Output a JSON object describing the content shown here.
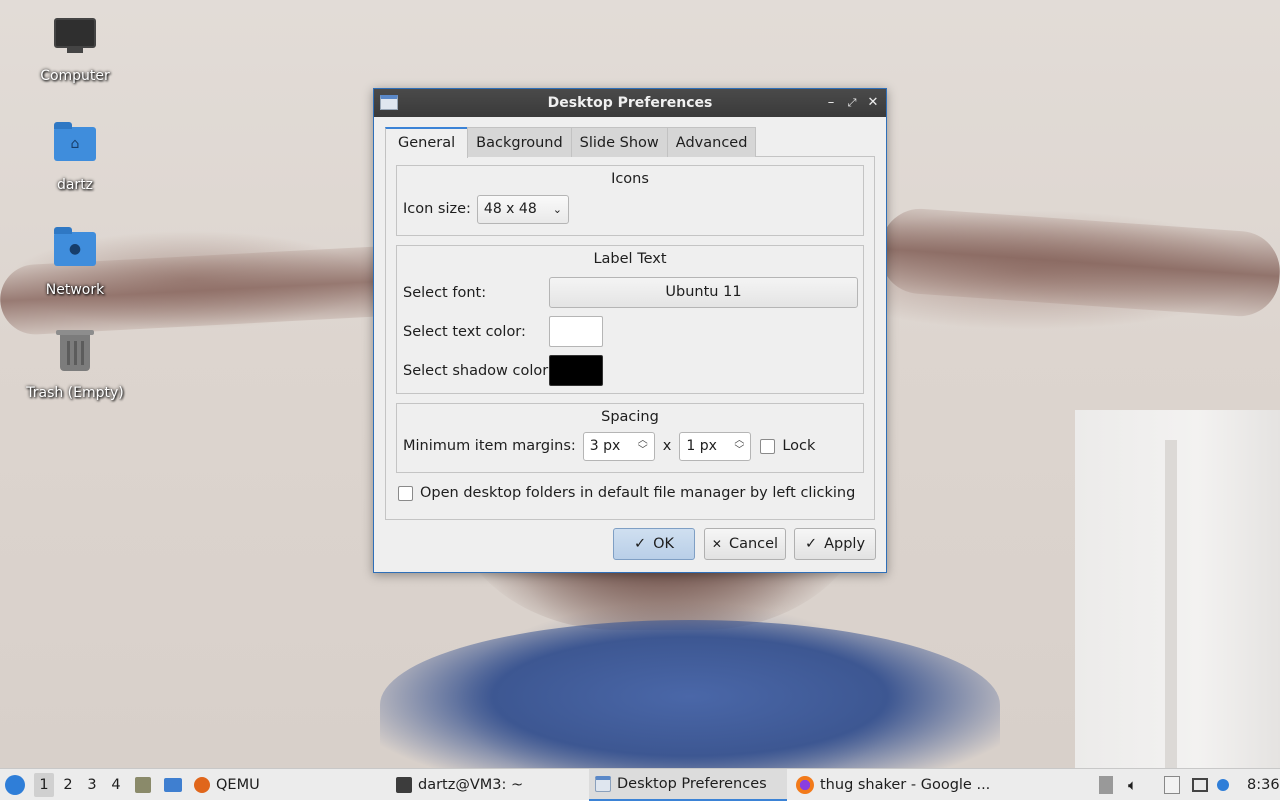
{
  "desktop": {
    "icons": [
      {
        "label": "Computer"
      },
      {
        "label": "dartz"
      },
      {
        "label": "Network"
      },
      {
        "label": "Trash (Empty)"
      }
    ]
  },
  "dialog": {
    "title": "Desktop Preferences",
    "tabs": [
      "General",
      "Background",
      "Slide Show",
      "Advanced"
    ],
    "active_tab": "General",
    "icons_section": {
      "title": "Icons",
      "icon_size_label": "Icon size:",
      "icon_size_value": "48 x 48"
    },
    "label_text_section": {
      "title": "Label Text",
      "select_font_label": "Select font:",
      "font_value": "Ubuntu 11",
      "text_color_label": "Select text color:",
      "text_color": "#ffffff",
      "shadow_color_label": "Select shadow color:",
      "shadow_color": "#000000"
    },
    "spacing_section": {
      "title": "Spacing",
      "margins_label": "Minimum item margins:",
      "margin_x": "3 px",
      "separator": "x",
      "margin_y": "1 px",
      "lock_label": "Lock",
      "lock_checked": false
    },
    "open_folders_label": "Open desktop folders in default file manager by left clicking",
    "open_folders_checked": false,
    "buttons": {
      "ok": "OK",
      "cancel": "Cancel",
      "apply": "Apply"
    }
  },
  "taskbar": {
    "workspaces": [
      "1",
      "2",
      "3",
      "4"
    ],
    "active_workspace": "1",
    "tasks": [
      {
        "label": "QEMU"
      },
      {
        "label": "dartz@VM3: ~"
      },
      {
        "label": "Desktop Preferences"
      },
      {
        "label": "thug shaker - Google ..."
      }
    ],
    "clock": "8:36"
  },
  "colors": {
    "accent": "#3b83d6",
    "titlebar": "#3f3f3f",
    "folder": "#3f8ddc"
  }
}
